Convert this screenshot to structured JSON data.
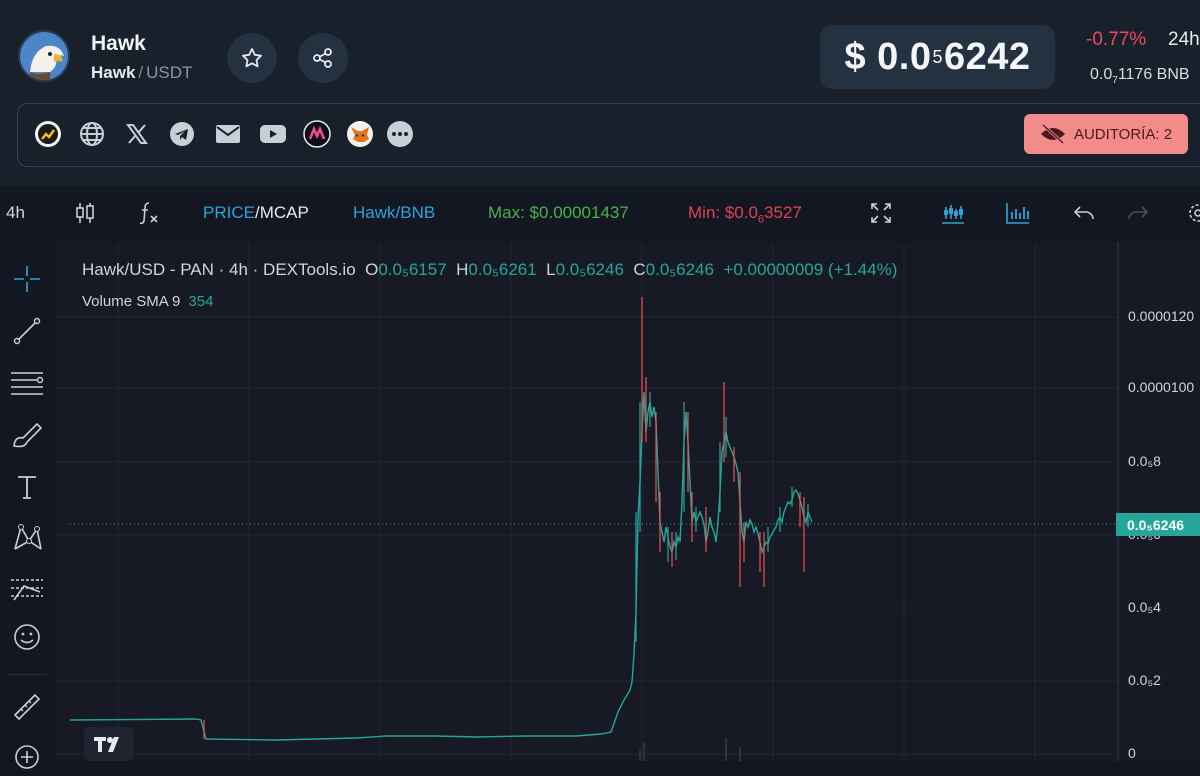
{
  "token": {
    "name": "Hawk",
    "base": "Hawk",
    "separator": "/",
    "quote": "USDT"
  },
  "price": {
    "prefix": "$ 0.0",
    "subscript": "5",
    "digits": "6242",
    "change": "-0.77%",
    "period": "24h",
    "bnb_prefix": "0.0",
    "bnb_subscript": "7",
    "bnb_digits": "1176",
    "bnb_unit": "BNB"
  },
  "social_links": [
    "chart-site-icon",
    "globe-icon",
    "x-icon",
    "telegram-icon",
    "mail-icon",
    "youtube-icon",
    "app-icon",
    "metamask-icon",
    "more-icon"
  ],
  "audit": {
    "label": "AUDITORÍA: 2"
  },
  "toolbar": {
    "interval": "4h",
    "price_label": "PRICE",
    "mcap_label": "/MCAP",
    "pair_label": "Hawk/BNB",
    "max_label": "Max: $0.00001437",
    "min_prefix": "Min: $0.0",
    "min_subscript": "6",
    "min_digits": "3527"
  },
  "legend": {
    "title": "Hawk/USD - PAN · 4h · DEXTools.io",
    "o_key": "O",
    "o_val": "0.0₅6157",
    "h_key": "H",
    "h_val": "0.0₅6261",
    "l_key": "L",
    "l_val": "0.0₅6246",
    "c_key": "C",
    "c_val": "0.0₅6246",
    "change": "+0.00000009 (+1.44%)",
    "volume_label": "Volume SMA 9",
    "volume_value": "354"
  },
  "axis": {
    "labels": [
      "0.0000120",
      "0.0000100",
      "0.0₅8",
      "0.0₅6",
      "0.0₅4",
      "0.0₅2",
      "0"
    ],
    "current_price": "0.0₅6246"
  },
  "colors": {
    "up": "#26a69a",
    "down": "#ef5350",
    "accent": "#2fa3d6",
    "audit_bg": "#f38b8b"
  }
}
